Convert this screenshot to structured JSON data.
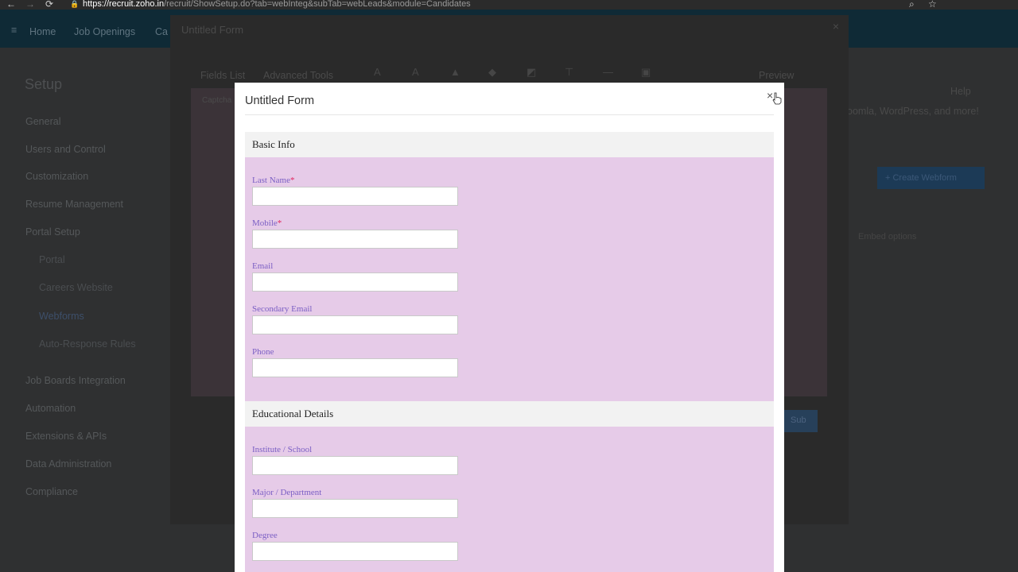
{
  "browser": {
    "back_icon": "←",
    "forward_icon": "→",
    "reload_icon": "⟳",
    "url_host": "https://recruit.zoho.in",
    "url_path": "/recruit/ShowSetup.do?tab=webInteg&subTab=webLeads&module=Candidates",
    "zoom_icon": "⌕",
    "star_icon": "☆"
  },
  "app_header": {
    "menu_icon": "≡",
    "items": [
      "Home",
      "Job Openings",
      "Ca"
    ]
  },
  "setup": {
    "title": "Setup",
    "sidebar": [
      "General",
      "Users and Control",
      "Customization",
      "Resume Management",
      "Portal Setup",
      "Portal",
      "Careers Website",
      "Webforms",
      "Auto-Response Rules",
      "Job Boards Integration",
      "Automation",
      "Extensions & APIs",
      "Data Administration",
      "Compliance"
    ]
  },
  "background_dialog": {
    "title": "Untitled Form",
    "close": "×",
    "tabs": [
      "Fields List",
      "Advanced Tools"
    ],
    "preview": "Preview",
    "captcha": "Captcha",
    "submit": "Sub"
  },
  "right_panel": {
    "help": "Help",
    "text": "oomla, WordPress, and more!",
    "button": "+ Create Webform",
    "embed": "Embed options"
  },
  "modal": {
    "title": "Untitled Form",
    "close_label": "×",
    "sections": [
      {
        "heading": "Basic Info",
        "fields": [
          {
            "label": "Last Name",
            "required": "*",
            "value": ""
          },
          {
            "label": "Mobile",
            "required": "*",
            "value": ""
          },
          {
            "label": "Email",
            "required": "",
            "value": ""
          },
          {
            "label": "Secondary Email",
            "required": "",
            "value": ""
          },
          {
            "label": "Phone",
            "required": "",
            "value": ""
          }
        ]
      },
      {
        "heading": "Educational Details",
        "fields": [
          {
            "label": "Institute / School",
            "required": "",
            "value": ""
          },
          {
            "label": "Major / Department",
            "required": "",
            "value": ""
          },
          {
            "label": "Degree",
            "required": "",
            "value": ""
          }
        ]
      }
    ]
  },
  "colors": {
    "section_body": "#e6cbe8",
    "label": "#7b5fc4",
    "required": "#e0245e"
  }
}
